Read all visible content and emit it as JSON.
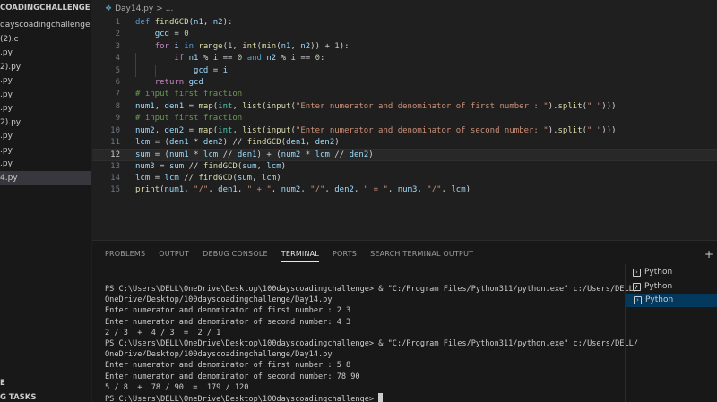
{
  "sidebar": {
    "folder": "COADINGCHALLENGE",
    "items": [
      {
        "label": "dayscoadingchallenge.co...",
        "active": false
      },
      {
        "label": "(2).c",
        "active": false
      },
      {
        "label": ".py",
        "active": false
      },
      {
        "label": "2).py",
        "active": false
      },
      {
        "label": ".py",
        "active": false
      },
      {
        "label": ".py",
        "active": false
      },
      {
        "label": ".py",
        "active": false
      },
      {
        "label": "2).py",
        "active": false
      },
      {
        "label": ".py",
        "active": false
      },
      {
        "label": ".py",
        "active": false
      },
      {
        "label": ".py",
        "active": false
      },
      {
        "label": "4.py",
        "active": true
      }
    ],
    "section_a": "E",
    "section_b": "G TASKS"
  },
  "editor": {
    "breadcrumb_file": "Day14.py",
    "breadcrumb_sep": ">",
    "breadcrumb_rest": "...",
    "current_line": 12,
    "lines": [
      {
        "n": "1",
        "t": "def findGCD(n1, n2):"
      },
      {
        "n": "2",
        "t": "    gcd = 0"
      },
      {
        "n": "3",
        "t": "    for i in range(1, int(min(n1, n2)) + 1):"
      },
      {
        "n": "4",
        "t": "        if n1 % i == 0 and n2 % i == 0:"
      },
      {
        "n": "5",
        "t": "            gcd = i"
      },
      {
        "n": "6",
        "t": "    return gcd"
      },
      {
        "n": "7",
        "t": "# input first fraction"
      },
      {
        "n": "8",
        "t": "num1, den1 = map(int, list(input(\"Enter numerator and denominator of first number : \").split(\" \")))"
      },
      {
        "n": "9",
        "t": "# input first fraction"
      },
      {
        "n": "10",
        "t": "num2, den2 = map(int, list(input(\"Enter numerator and denominator of second number: \").split(\" \")))"
      },
      {
        "n": "11",
        "t": "lcm = (den1 * den2) // findGCD(den1, den2)"
      },
      {
        "n": "12",
        "t": "sum = (num1 * lcm // den1) + (num2 * lcm // den2)"
      },
      {
        "n": "13",
        "t": "num3 = sum // findGCD(sum, lcm)"
      },
      {
        "n": "14",
        "t": "lcm = lcm // findGCD(sum, lcm)"
      },
      {
        "n": "15",
        "t": "print(num1, \"/\", den1, \" + \", num2, \"/\", den2, \" = \", num3, \"/\", lcm)"
      }
    ]
  },
  "panel": {
    "tabs": [
      {
        "label": "PROBLEMS",
        "active": false
      },
      {
        "label": "OUTPUT",
        "active": false
      },
      {
        "label": "DEBUG CONSOLE",
        "active": false
      },
      {
        "label": "TERMINAL",
        "active": true
      },
      {
        "label": "PORTS",
        "active": false
      },
      {
        "label": "SEARCH TERMINAL OUTPUT",
        "active": false
      }
    ],
    "plus": "+",
    "terminal_lines": [
      "PS C:\\Users\\DELL\\OneDrive\\Desktop\\100dayscoadingchallenge> & \"C:/Program Files/Python311/python.exe\" c:/Users/DELL/",
      "OneDrive/Desktop/100dayscoadingchallenge/Day14.py",
      "Enter numerator and denominator of first number : 2 3",
      "Enter numerator and denominator of second number: 4 3",
      "2 / 3  +  4 / 3  =  2 / 1",
      "PS C:\\Users\\DELL\\OneDrive\\Desktop\\100dayscoadingchallenge> & \"C:/Program Files/Python311/python.exe\" c:/Users/DELL/",
      "OneDrive/Desktop/100dayscoadingchallenge/Day14.py",
      "Enter numerator and denominator of first number : 5 8",
      "Enter numerator and denominator of second number: 78 90",
      "5 / 8  +  78 / 90  =  179 / 120",
      "PS C:\\Users\\DELL\\OneDrive\\Desktop\\100dayscoadingchallenge> "
    ],
    "terminals": [
      {
        "label": "Python",
        "active": false
      },
      {
        "label": "Python",
        "active": false
      },
      {
        "label": "Python",
        "active": true
      }
    ]
  }
}
